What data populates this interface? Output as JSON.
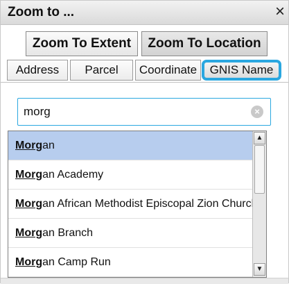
{
  "window": {
    "title": "Zoom to ...",
    "close_glyph": "×"
  },
  "modes": [
    {
      "label": "Zoom To Extent"
    },
    {
      "label": "Zoom To Location"
    }
  ],
  "tabs": [
    {
      "label": "Address"
    },
    {
      "label": "Parcel"
    },
    {
      "label": "Coordinate"
    },
    {
      "label": "GNIS Name"
    }
  ],
  "search": {
    "value": "morg",
    "query_match": "Morg"
  },
  "suggestions": [
    {
      "match": "Morg",
      "rest": "an"
    },
    {
      "match": "Morg",
      "rest": "an Academy"
    },
    {
      "match": "Morg",
      "rest": "an African Methodist Episcopal Zion Church"
    },
    {
      "match": "Morg",
      "rest": "an Branch"
    },
    {
      "match": "Morg",
      "rest": "an Camp Run"
    }
  ],
  "colors": {
    "accent": "#2aa7e0",
    "highlight": "#b7cdee"
  },
  "icons": {
    "clear": "clear-icon",
    "close": "close-icon",
    "scroll_up": "scroll-up-icon",
    "scroll_down": "scroll-down-icon"
  }
}
